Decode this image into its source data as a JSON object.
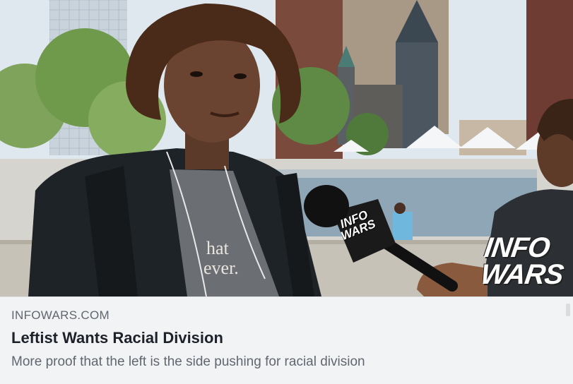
{
  "link_card": {
    "domain": "INFOWARS.COM",
    "headline": "Leftist Wants Racial Division",
    "description": "More proof that the left is the side pushing for racial division"
  },
  "image": {
    "watermark_line1": "INFO",
    "watermark_line2": "WARS",
    "mic_flag_text": "INFO WARS",
    "shirt_text_line1": "hat",
    "shirt_text_line2": "ever."
  },
  "colors": {
    "card_background": "#f2f3f5",
    "domain_text": "#606770",
    "headline_text": "#1d2129",
    "description_text": "#606770"
  }
}
